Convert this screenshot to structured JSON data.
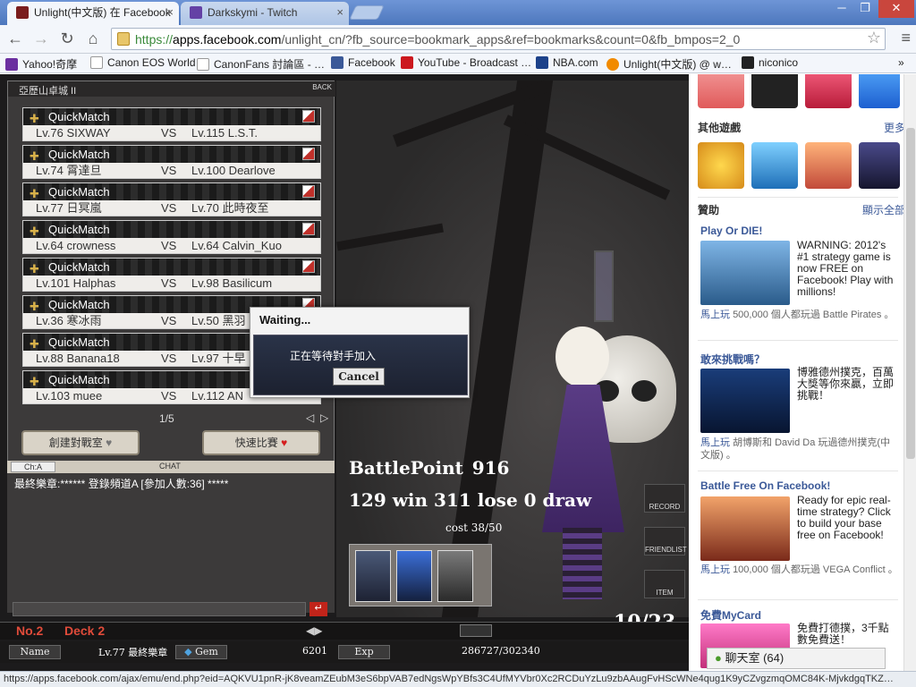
{
  "browser": {
    "tabs": [
      {
        "title": "Unlight(中文版) 在 Facebook",
        "close": "×",
        "active": true
      },
      {
        "title": "Darkskymi - Twitch",
        "close": "×",
        "active": false
      }
    ],
    "window_controls": [
      "─",
      "❐",
      "✕"
    ],
    "nav": {
      "back": "←",
      "forward": "→",
      "reload": "↻",
      "home": "⌂"
    },
    "url_scheme": "https://",
    "url_host": "apps.facebook.com",
    "url_path": "/unlight_cn/?fb_source=bookmark_apps&ref=bookmarks&count=0&fb_bmpos=2_0",
    "bookmarks": [
      {
        "label": "Yahoo!奇摩",
        "icon": "yahoo-icon",
        "color": "#6b2fa0"
      },
      {
        "label": "Canon EOS World",
        "icon": "page-icon",
        "color": "#ffffff"
      },
      {
        "label": "CanonFans 討論區 - …",
        "icon": "canonfans-icon",
        "color": "#ffffff"
      },
      {
        "label": "Facebook",
        "icon": "facebook-icon",
        "color": "#3b5998"
      },
      {
        "label": "YouTube - Broadcast …",
        "icon": "youtube-icon",
        "color": "#cc181e"
      },
      {
        "label": "NBA.com",
        "icon": "nba-icon",
        "color": "#1d428a"
      },
      {
        "label": "Unlight(中文版) @ w…",
        "icon": "at-icon",
        "color": "#f18a00"
      },
      {
        "label": "niconico",
        "icon": "niconico-icon",
        "color": "#222222"
      }
    ],
    "bookmarks_more": "»",
    "status_url": "https://apps.facebook.com/ajax/emu/end.php?eid=AQKVU1pnR-jK8veamZEubM3eS6bpVAB7edNgsWpYBfs3C4UfMYVbr0Xc2RCDuYzLu9zbAAugFvHScWNe4qug1K9yCZvgzmqOMC84K-MjvkdgqTKZ…"
  },
  "game": {
    "top_label": "亞歷山卓城 II",
    "back_label": "BACK",
    "match_header": "QuickMatch",
    "vs": "VS",
    "matches": [
      {
        "left": "Lv.76 SIXWAY",
        "right": "Lv.115 L.S.T."
      },
      {
        "left": "Lv.74 霄達旦",
        "right": "Lv.100 Dearlove"
      },
      {
        "left": "Lv.77 日冥嵐",
        "right": "Lv.70 此時夜至"
      },
      {
        "left": "Lv.64 crowness",
        "right": "Lv.64 Calvin_Kuo"
      },
      {
        "left": "Lv.101 Halphas",
        "right": "Lv.98 Basilicum"
      },
      {
        "left": "Lv.36 寒冰雨",
        "right": "Lv.50 黑羽"
      },
      {
        "left": "Lv.88 Banana18",
        "right": "Lv.97 十早"
      },
      {
        "left": "Lv.103 muee",
        "right": "Lv.112 AN"
      }
    ],
    "pager": "1/5",
    "create_room_label": "創建對戰室",
    "quick_match_label": "快速比賽",
    "chat_channel": "Ch:A",
    "chat_label": "CHAT",
    "chat_message": "最終樂章:****** 登錄頻道A [參加人數:36] *****",
    "chat_send": "↵",
    "battle_point_label": "BattlePoint",
    "battle_point": "916",
    "record": "129 win  311 lose  0 draw",
    "cost": "cost 38/50",
    "side_buttons": [
      "RECORD",
      "FRIENDLIST",
      "ITEM"
    ],
    "counter": "10/23",
    "deck_no": "No.2",
    "deck_name": "Deck 2",
    "name_label": "Name",
    "player_name": "Lv.77 最終樂章",
    "gem_label": "Gem",
    "gem": "6201",
    "exp_label": "Exp",
    "exp": "286727/302340"
  },
  "dialog": {
    "title": "Waiting...",
    "message": "正在等待對手加入",
    "cancel": "Cancel"
  },
  "sidebar": {
    "other_games": "其他遊戲",
    "more": "更多",
    "sponsored": "贊助",
    "show_all": "顯示全部",
    "ads": [
      {
        "title": "Play Or DIE!",
        "text": "WARNING: 2012's #1 strategy game is now FREE on Facebook! Play with millions!",
        "social_link": "馬上玩",
        "social": "500,000 個人都玩過 Battle Pirates 。"
      },
      {
        "title": "敢來挑戰嗎？",
        "text": "博雅德州撲克，百萬大獎等你來贏，立即挑戰！",
        "social_link": "馬上玩",
        "social": "胡博斯和 David Da 玩過德州撲克(中文版) 。"
      },
      {
        "title": "Battle Free On Facebook!",
        "text": "Ready for epic real-time strategy? Click to build your base free on Facebook!",
        "social_link": "馬上玩",
        "social": "100,000 個人都玩過 VEGA Conflict 。"
      },
      {
        "title": "免費MyCard",
        "text": "免費打德撲，3千點數免費送！",
        "social_link": "",
        "social": ""
      }
    ],
    "chat_room": "聊天室 (64)"
  },
  "colors": {
    "tab_bar": "#5b84c8",
    "fb_link": "#3b5998",
    "game_bg": "#1c1b1c",
    "accent_red": "#e04b3a"
  }
}
